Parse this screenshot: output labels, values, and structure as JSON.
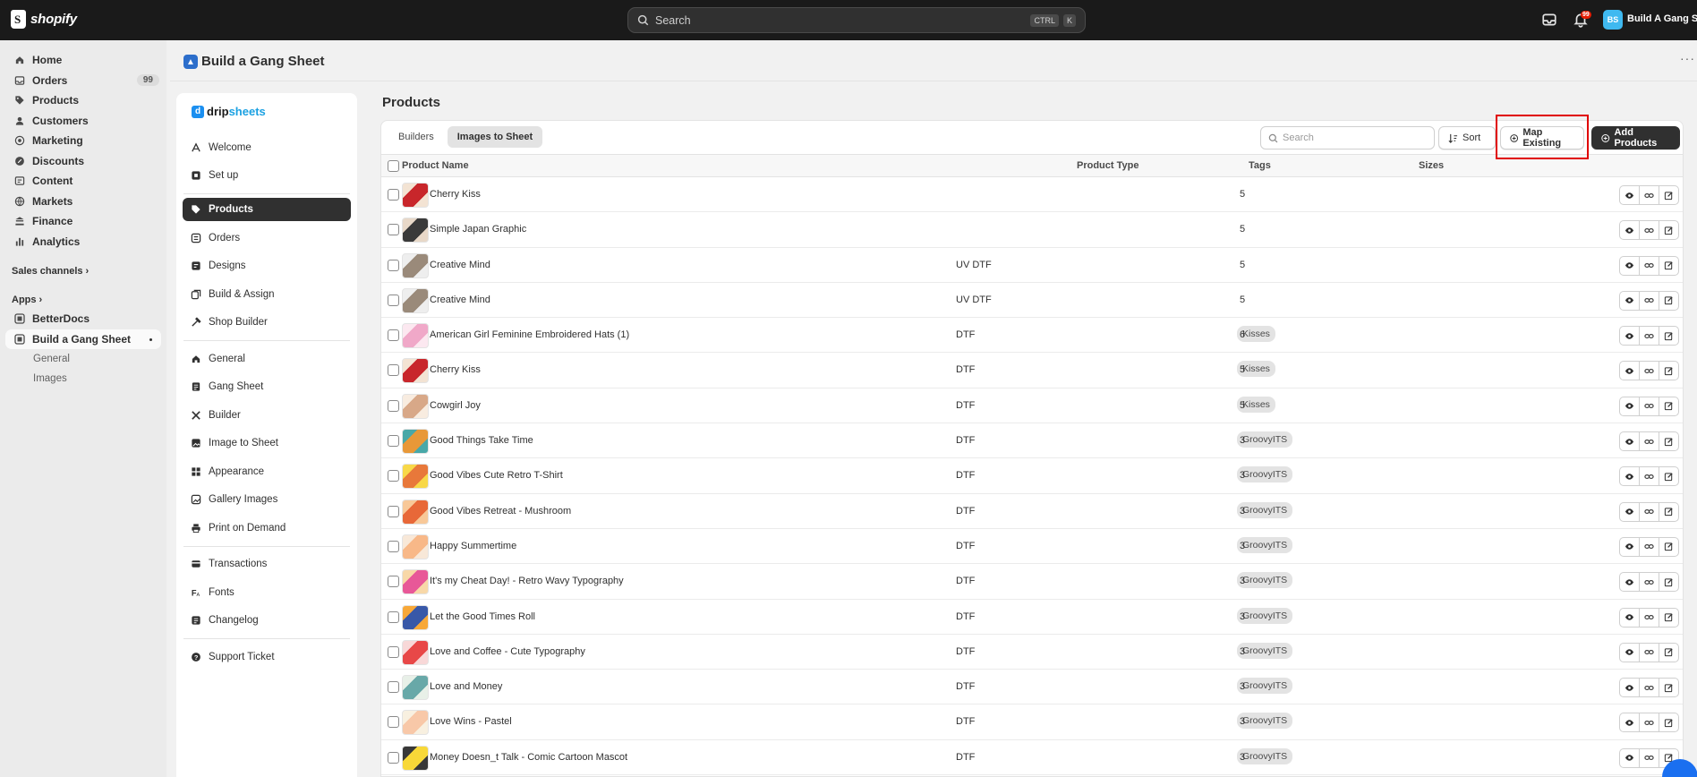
{
  "topbar": {
    "brand": "shopify",
    "search_placeholder": "Search",
    "kbd_ctrl": "CTRL",
    "kbd_k": "K",
    "notif_count": "99",
    "store_initials": "BS",
    "store_name": "Build A Gang She"
  },
  "admin_nav": {
    "items": [
      {
        "label": "Home",
        "icon": "home-icon"
      },
      {
        "label": "Orders",
        "icon": "inbox-icon",
        "count": "99"
      },
      {
        "label": "Products",
        "icon": "tag-icon"
      },
      {
        "label": "Customers",
        "icon": "person-icon"
      },
      {
        "label": "Marketing",
        "icon": "target-icon"
      },
      {
        "label": "Discounts",
        "icon": "discount-icon"
      },
      {
        "label": "Content",
        "icon": "content-icon"
      },
      {
        "label": "Markets",
        "icon": "globe-icon"
      },
      {
        "label": "Finance",
        "icon": "bank-icon"
      },
      {
        "label": "Analytics",
        "icon": "chart-icon"
      }
    ],
    "sales_channels": "Sales channels",
    "apps": "Apps",
    "app_items": [
      {
        "label": "BetterDocs"
      },
      {
        "label": "Build a Gang Sheet"
      }
    ],
    "sub_items": [
      "General",
      "Images"
    ]
  },
  "app_header": {
    "title": "Build a Gang Sheet",
    "more": "···"
  },
  "app_sidebar": {
    "brand_part1": "drip",
    "brand_part2": "sheets",
    "groups": [
      [
        {
          "label": "Welcome",
          "icon": "wave-icon"
        },
        {
          "label": "Set up",
          "icon": "setup-icon"
        }
      ],
      [
        {
          "label": "Products",
          "icon": "tag-icon",
          "active": true
        },
        {
          "label": "Orders",
          "icon": "list-icon"
        },
        {
          "label": "Designs",
          "icon": "design-icon"
        },
        {
          "label": "Build & Assign",
          "icon": "build-icon"
        },
        {
          "label": "Shop Builder",
          "icon": "hammer-icon"
        }
      ],
      [
        {
          "label": "General",
          "icon": "home-icon"
        },
        {
          "label": "Gang Sheet",
          "icon": "sheet-icon"
        },
        {
          "label": "Builder",
          "icon": "tools-icon"
        },
        {
          "label": "Image to Sheet",
          "icon": "image-icon"
        },
        {
          "label": "Appearance",
          "icon": "grid-icon"
        },
        {
          "label": "Gallery Images",
          "icon": "gallery-icon"
        },
        {
          "label": "Print on Demand",
          "icon": "printer-icon"
        }
      ],
      [
        {
          "label": "Transactions",
          "icon": "card-icon"
        },
        {
          "label": "Fonts",
          "icon": "font-icon"
        },
        {
          "label": "Changelog",
          "icon": "changelog-icon"
        }
      ],
      [
        {
          "label": "Support Ticket",
          "icon": "help-icon"
        }
      ]
    ]
  },
  "main": {
    "page_title": "Products",
    "tabs": [
      {
        "label": "Builders"
      },
      {
        "label": "Images to Sheet",
        "active": true
      }
    ],
    "search_placeholder": "Search",
    "sort_label": "Sort",
    "map_existing_label": "Map Existing",
    "add_products_label": "Add Products",
    "columns": [
      "Product Name",
      "Product Type",
      "Tags",
      "Sizes"
    ],
    "rows": [
      {
        "name": "Cherry Kiss",
        "type": "",
        "tag": "",
        "sizes": "5",
        "thumb": [
          "#c8262b",
          "#f3e3d3"
        ]
      },
      {
        "name": "Simple Japan Graphic",
        "type": "",
        "tag": "",
        "sizes": "5",
        "thumb": [
          "#3a3a3a",
          "#e8d8c8"
        ]
      },
      {
        "name": "Creative Mind",
        "type": "UV DTF",
        "tag": "",
        "sizes": "5",
        "thumb": [
          "#9a8a7a",
          "#eeeeee"
        ]
      },
      {
        "name": "Creative Mind",
        "type": "UV DTF",
        "tag": "",
        "sizes": "5",
        "thumb": [
          "#9a8a7a",
          "#eeeeee"
        ]
      },
      {
        "name": "American Girl Feminine Embroidered Hats (1)",
        "type": "DTF",
        "tag": "Kisses",
        "sizes": "6",
        "thumb": [
          "#f0a8c8",
          "#fce8f0"
        ]
      },
      {
        "name": "Cherry Kiss",
        "type": "DTF",
        "tag": "Kisses",
        "sizes": "5",
        "thumb": [
          "#c8262b",
          "#f3e3d3"
        ]
      },
      {
        "name": "Cowgirl Joy",
        "type": "DTF",
        "tag": "Kisses",
        "sizes": "5",
        "thumb": [
          "#d8a888",
          "#f8ece0"
        ]
      },
      {
        "name": "Good Things Take Time",
        "type": "DTF",
        "tag": "GroovyITS",
        "sizes": "3",
        "thumb": [
          "#e89838",
          "#48a8a8"
        ]
      },
      {
        "name": "Good Vibes Cute Retro T-Shirt",
        "type": "DTF",
        "tag": "GroovyITS",
        "sizes": "3",
        "thumb": [
          "#e8783a",
          "#f8d848"
        ]
      },
      {
        "name": "Good Vibes Retreat - Mushroom",
        "type": "DTF",
        "tag": "GroovyITS",
        "sizes": "3",
        "thumb": [
          "#e86838",
          "#f8c898"
        ]
      },
      {
        "name": "Happy Summertime",
        "type": "DTF",
        "tag": "GroovyITS",
        "sizes": "3",
        "thumb": [
          "#f8b888",
          "#f8e8d8"
        ]
      },
      {
        "name": "It's my Cheat Day! - Retro Wavy Typography",
        "type": "DTF",
        "tag": "GroovyITS",
        "sizes": "3",
        "thumb": [
          "#e85898",
          "#f8d8a8"
        ]
      },
      {
        "name": "Let the Good Times Roll",
        "type": "DTF",
        "tag": "GroovyITS",
        "sizes": "3",
        "thumb": [
          "#3858a8",
          "#f8a838"
        ]
      },
      {
        "name": "Love and Coffee - Cute Typography",
        "type": "DTF",
        "tag": "GroovyITS",
        "sizes": "3",
        "thumb": [
          "#e84848",
          "#f8d8d8"
        ]
      },
      {
        "name": "Love and Money",
        "type": "DTF",
        "tag": "GroovyITS",
        "sizes": "3",
        "thumb": [
          "#68a8a8",
          "#e8f0e8"
        ]
      },
      {
        "name": "Love Wins - Pastel",
        "type": "DTF",
        "tag": "GroovyITS",
        "sizes": "3",
        "thumb": [
          "#f8c8a8",
          "#f8f0e0"
        ]
      },
      {
        "name": "Money Doesn_t Talk - Comic Cartoon Mascot",
        "type": "DTF",
        "tag": "GroovyITS",
        "sizes": "3",
        "thumb": [
          "#f8d838",
          "#383838"
        ]
      }
    ]
  }
}
